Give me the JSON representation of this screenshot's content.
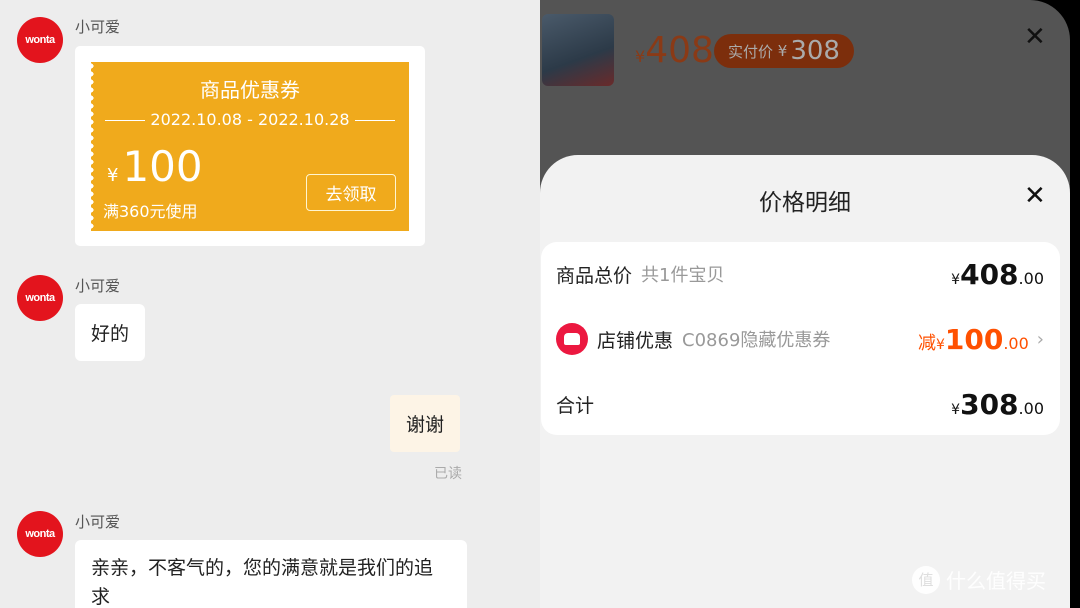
{
  "chat": {
    "avatar_logo": "wonta",
    "messages": [
      {
        "sender": "小可爱",
        "type": "coupon"
      },
      {
        "sender": "小可爱",
        "text": "好的"
      },
      {
        "self": true,
        "text": "谢谢",
        "status": "已读"
      },
      {
        "sender": "小可爱",
        "text": "亲亲，不客气的，您的满意就是我们的追求"
      }
    ],
    "coupon": {
      "title": "商品优惠券",
      "date_range": "2022.10.08 - 2022.10.28",
      "currency": "¥",
      "amount": "100",
      "condition": "满360元使用",
      "button": "去领取",
      "color": "#f0aa1c"
    }
  },
  "product_bar": {
    "currency": "¥",
    "price": "408",
    "actual_label": "实付价",
    "actual_currency": "¥",
    "actual_price": "308",
    "close": "✕"
  },
  "price_detail": {
    "title": "价格明细",
    "close": "✕",
    "rows": [
      {
        "label": "商品总价",
        "sub": "共1件宝贝",
        "prefix": "",
        "currency": "¥",
        "int": "408",
        "dec": ".00"
      },
      {
        "label": "店铺优惠",
        "sub": "C0869隐藏优惠券",
        "prefix": "减",
        "currency": "¥",
        "int": "100",
        "dec": ".00",
        "icon": "shop-icon",
        "color": "#ff5000"
      },
      {
        "label": "合计",
        "sub": "",
        "prefix": "",
        "currency": "¥",
        "int": "308",
        "dec": ".00"
      }
    ]
  },
  "watermark": {
    "badge": "值",
    "text": "什么值得买"
  }
}
